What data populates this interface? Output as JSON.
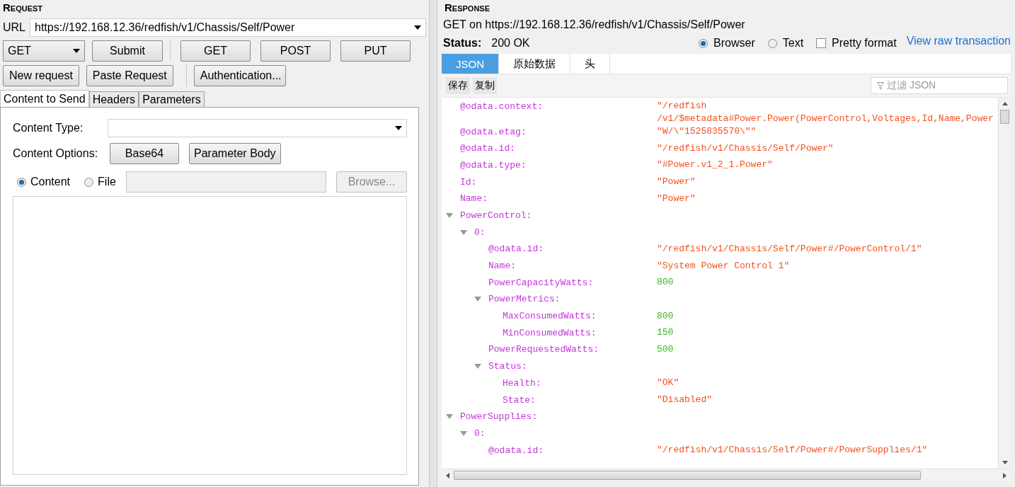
{
  "request": {
    "title": "Request",
    "url_label": "URL",
    "url": "https://192.168.12.36/redfish/v1/Chassis/Self/Power",
    "method": "GET",
    "submit": "Submit",
    "quick_methods": [
      "GET",
      "POST",
      "PUT"
    ],
    "actions": [
      "New request",
      "Paste Request"
    ],
    "auth_button": "Authentication...",
    "tabs": [
      {
        "label": "Content to Send",
        "selected": true
      },
      {
        "label": "Headers",
        "selected": false
      },
      {
        "label": "Parameters",
        "selected": false
      }
    ],
    "content_type_label": "Content Type:",
    "content_options_label": "Content Options:",
    "content_options": [
      "Base64",
      "Parameter Body"
    ],
    "source": [
      {
        "label": "Content",
        "selected": true
      },
      {
        "label": "File",
        "selected": false
      }
    ],
    "browse": {
      "label": "Browse...",
      "disabled": true
    }
  },
  "response": {
    "title": "Response",
    "summary": "GET on https://192.168.12.36/redfish/v1/Chassis/Self/Power",
    "status_label": "Status:",
    "status": "200 OK",
    "view_modes": [
      {
        "label": "Browser",
        "selected": true
      },
      {
        "label": "Text",
        "selected": false
      }
    ],
    "pretty_format": {
      "label": "Pretty format",
      "checked": false
    },
    "raw_link": "View raw transaction",
    "tabs": [
      {
        "label": "JSON",
        "selected": true
      },
      {
        "label": "原始数据",
        "selected": false
      },
      {
        "label": "头",
        "selected": false
      }
    ],
    "toolbar": [
      "保存",
      "复制"
    ],
    "filter": {
      "placeholder": "过滤 JSON"
    },
    "tree": [
      {
        "key": "@odata.context:",
        "kind": "string",
        "value_lines": [
          "\"/redfish",
          "/v1/$metadata#Power.Power(PowerControl,Voltages,Id,Name,Power"
        ]
      },
      {
        "key": "@odata.etag:",
        "kind": "string",
        "value": "\"W/\\\"1525835570\\\"\""
      },
      {
        "key": "@odata.id:",
        "kind": "string",
        "value": "\"/redfish/v1/Chassis/Self/Power\""
      },
      {
        "key": "@odata.type:",
        "kind": "string",
        "value": "\"#Power.v1_2_1.Power\""
      },
      {
        "key": "Id:",
        "kind": "string",
        "value": "\"Power\""
      },
      {
        "key": "Name:",
        "kind": "string",
        "value": "\"Power\""
      },
      {
        "key": "PowerControl:",
        "kind": "object",
        "expanded": true,
        "children": [
          {
            "key": "0:",
            "kind": "object",
            "expanded": true,
            "children": [
              {
                "key": "@odata.id:",
                "kind": "string",
                "value": "\"/redfish/v1/Chassis/Self/Power#/PowerControl/1\""
              },
              {
                "key": "Name:",
                "kind": "string",
                "value": "\"System Power Control 1\""
              },
              {
                "key": "PowerCapacityWatts:",
                "kind": "number",
                "value": "800"
              },
              {
                "key": "PowerMetrics:",
                "kind": "object",
                "expanded": true,
                "children": [
                  {
                    "key": "MaxConsumedWatts:",
                    "kind": "number",
                    "value": "800"
                  },
                  {
                    "key": "MinConsumedWatts:",
                    "kind": "number",
                    "value": "150"
                  }
                ]
              },
              {
                "key": "PowerRequestedWatts:",
                "kind": "number",
                "value": "500"
              },
              {
                "key": "Status:",
                "kind": "object",
                "expanded": true,
                "children": [
                  {
                    "key": "Health:",
                    "kind": "string",
                    "value": "\"OK\""
                  },
                  {
                    "key": "State:",
                    "kind": "string",
                    "value": "\"Disabled\""
                  }
                ]
              }
            ]
          }
        ]
      },
      {
        "key": "PowerSupplies:",
        "kind": "object",
        "expanded": true,
        "children": [
          {
            "key": "0:",
            "kind": "object",
            "expanded": true,
            "children": [
              {
                "key": "@odata.id:",
                "kind": "string",
                "value": "\"/redfish/v1/Chassis/Self/Power#/PowerSupplies/1\""
              }
            ]
          }
        ]
      }
    ]
  }
}
